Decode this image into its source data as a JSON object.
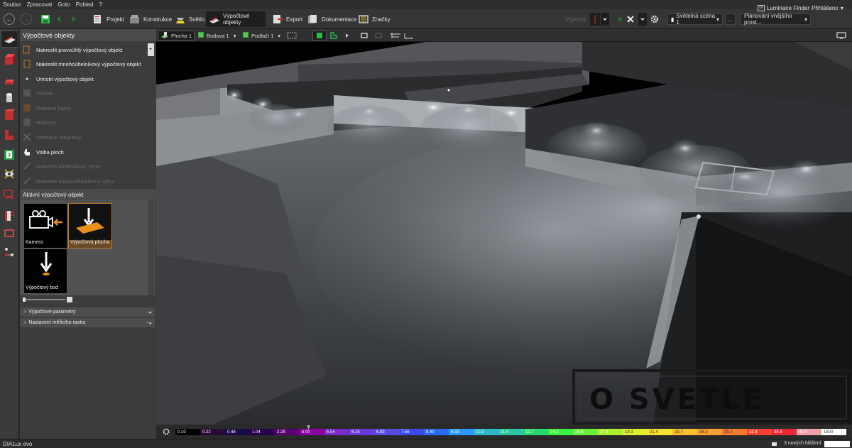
{
  "menu": [
    "Soubor",
    "Zpracovat",
    "Goto",
    "Pohled",
    "?"
  ],
  "toolbar": {
    "tabs": [
      "Projekt",
      "Konstrukce",
      "Světlo",
      "Výpočtové objekty",
      "Export",
      "Dokumentace",
      "Značky"
    ],
    "active_tab": "Výpočtové objekty",
    "vypocet_label": "Výpočet",
    "scene": "Světelná scéna 1",
    "scene_more": "...",
    "planning": "Plánování vnějšího prost...",
    "luminaire_finder": "Luminaire Finder",
    "login": "Přihlášeno"
  },
  "panel": {
    "title": "Výpočtové objekty",
    "tools": [
      {
        "label": "Nakreslit pravoúhlý výpočtový objekt",
        "enabled": true
      },
      {
        "label": "Nakreslit mnohoúhelníkový výpočtový objekt",
        "enabled": true
      },
      {
        "label": "Umístit výpočtový objekt",
        "enabled": true
      },
      {
        "label": "Izolinie",
        "enabled": false
      },
      {
        "label": "Nepravé barvy",
        "enabled": false
      },
      {
        "label": "Hodnoty",
        "enabled": false
      },
      {
        "label": "Odstranit diagramy",
        "enabled": false
      },
      {
        "label": "Volba ploch",
        "enabled": true
      },
      {
        "label": "Nakreslit obdélníkový výřez",
        "enabled": false
      },
      {
        "label": "Nakreslit mnohoúhelníkový výřez",
        "enabled": false
      }
    ],
    "active_title": "Aktivní výpočtový objekt",
    "objects": [
      {
        "label": "Kamera",
        "icon": "camera-icon"
      },
      {
        "label": "Výpočtová plocha",
        "icon": "calc-surface-icon"
      },
      {
        "label": "Výpočtový bod",
        "icon": "calc-point-icon"
      }
    ],
    "sections": [
      "Výpočtové parametry",
      "Nastavení měřicího rastru"
    ]
  },
  "viewport_toolbar": {
    "items": [
      "Plocha 1",
      "Budova 1",
      "Podlaží 1"
    ]
  },
  "legend": {
    "values": [
      "0.10",
      "0.22",
      "0.48",
      "1.04",
      "2.28",
      "5.00",
      "5.54",
      "6.15",
      "6.83",
      "7.56",
      "8.40",
      "9.33",
      "10.3",
      "11.4",
      "12.7",
      "14.1",
      "15.6",
      "17.4",
      "19.3",
      "21.4",
      "23.7",
      "26.3",
      "29.2",
      "32.4",
      "35.9",
      "45.0",
      "1500"
    ],
    "colors": [
      "#000000",
      "#2a0a3a",
      "#1a0a4a",
      "#2a0050",
      "#5a0070",
      "#8a00a0",
      "#7a2ac8",
      "#6a3ad8",
      "#5a4ae0",
      "#3a4af0",
      "#2a6af8",
      "#2a9af8",
      "#2ab8c8",
      "#2ac8a0",
      "#2ad870",
      "#3af040",
      "#6af038",
      "#a8f030",
      "#e0f030",
      "#f8e030",
      "#f8c030",
      "#f8a030",
      "#f87830",
      "#f84030",
      "#e82838",
      "#f0a0a8",
      "#ffffff"
    ]
  },
  "status": {
    "logo": "DIALux evo",
    "messages": "3 nových hlášení"
  },
  "watermark": {
    "text": "O SVETLE"
  }
}
